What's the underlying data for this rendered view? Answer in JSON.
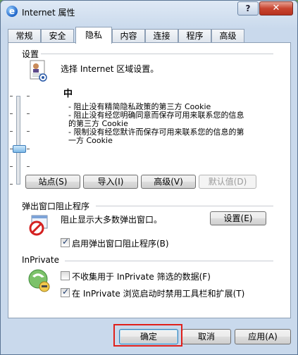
{
  "window": {
    "title": "Internet 属性",
    "help_glyph": "?",
    "close_glyph": "✕"
  },
  "tabs": [
    "常规",
    "安全",
    "隐私",
    "内容",
    "连接",
    "程序",
    "高级"
  ],
  "settings": {
    "group_label": "设置",
    "zone_prompt": "选择 Internet 区域设置。",
    "level_name": "中",
    "descriptions": [
      "- 阻止没有精简隐私政策的第三方 Cookie",
      "- 阻止没有经您明确同意而保存可用来联系您的信息",
      "  的第三方 Cookie",
      "- 限制没有经您默许而保存可用来联系您的信息的第",
      "  一方 Cookie"
    ],
    "slider_level": 2,
    "slider_levels": 6,
    "buttons": {
      "sites": "站点(S)",
      "import": "导入(I)",
      "advanced": "高级(V)",
      "default": "默认值(D)"
    }
  },
  "popup_blocker": {
    "group_label": "弹出窗口阻止程序",
    "description": "阻止显示大多数弹出窗口。",
    "settings_button": "设置(E)",
    "enable_label": "启用弹出窗口阻止程序(B)",
    "enable_checked": true
  },
  "inprivate": {
    "group_label": "InPrivate",
    "no_collect_label": "不收集用于 InPrivate 筛选的数据(F)",
    "no_collect_checked": false,
    "disable_toolbars_label": "在 InPrivate 浏览启动时禁用工具栏和扩展(T)",
    "disable_toolbars_checked": true
  },
  "footer": {
    "ok": "确定",
    "cancel": "取消",
    "apply": "应用(A)"
  }
}
